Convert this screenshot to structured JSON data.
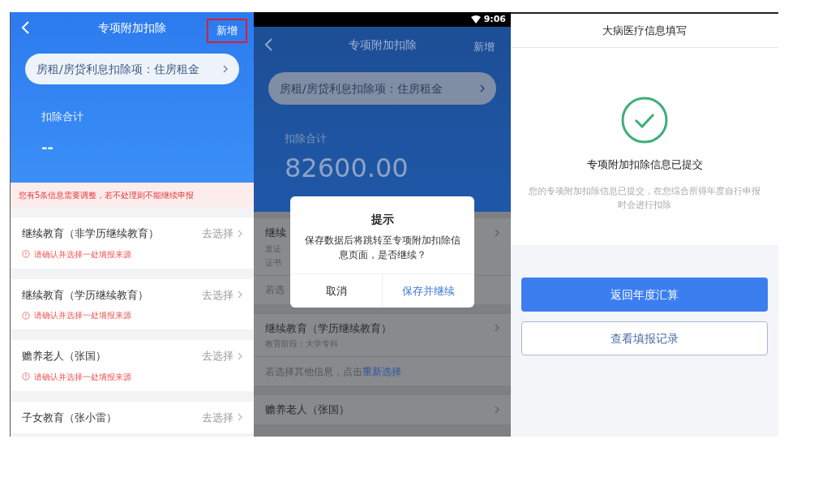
{
  "screen_1": {
    "nav": {
      "title": "专项附加扣除",
      "action": {
        "label": "新增",
        "highlighted": true
      }
    },
    "summary_pill": "房租/房贷利息扣除项：住房租金",
    "total_label": "扣除合计",
    "total_value": "--",
    "alert": "您有5条信息需要调整，若不处理则不能继续申报",
    "items": [
      {
        "title": "继续教育（非学历继续教育）",
        "action": "去选择",
        "warning": "请确认并选择一处填报来源"
      },
      {
        "title": "继续教育（学历继续教育）",
        "action": "去选择",
        "warning": "请确认并选择一处填报来源"
      },
      {
        "title": "赡养老人（张国）",
        "action": "去选择",
        "warning": "请确认并选择一处填报来源"
      },
      {
        "title": "子女教育（张小雷）",
        "action": "去选择"
      }
    ]
  },
  "screen_2": {
    "status_bar": {
      "time": "9:06"
    },
    "nav": {
      "title": "专项附加扣除",
      "action": {
        "label": "新增",
        "highlighted": false
      }
    },
    "summary_pill": "房租/房贷利息扣除项：住房租金",
    "total_label": "扣除合计",
    "total_value": "82600.00",
    "items": [
      {
        "title": "继续",
        "lines": [
          "发证",
          "证书"
        ],
        "footer": "若选"
      },
      {
        "title": "继续教育（学历继续教育）",
        "lines": [
          "教育阶段：大学专科"
        ],
        "footer": "若选择其他信息，点击**重新选择**"
      },
      {
        "title": "赡养老人（张国）"
      }
    ],
    "dialog": {
      "title": "提示",
      "message": "保存数据后将跳转至专项附加扣除信息页面，是否继续？",
      "buttons": [
        {
          "label": "取消",
          "primary": false
        },
        {
          "label": "保存并继续",
          "primary": true
        }
      ]
    }
  },
  "screen_3": {
    "title": "大病医疗信息填写",
    "result_title": "专项附加扣除信息已提交",
    "result_text": "您的专项附加扣除信息已提交，在您综合所得年度自行申报时会进行扣除",
    "buttons": [
      {
        "label": "返回年度汇算",
        "primary": true
      },
      {
        "label": "查看填报记录",
        "primary": false
      }
    ]
  }
}
